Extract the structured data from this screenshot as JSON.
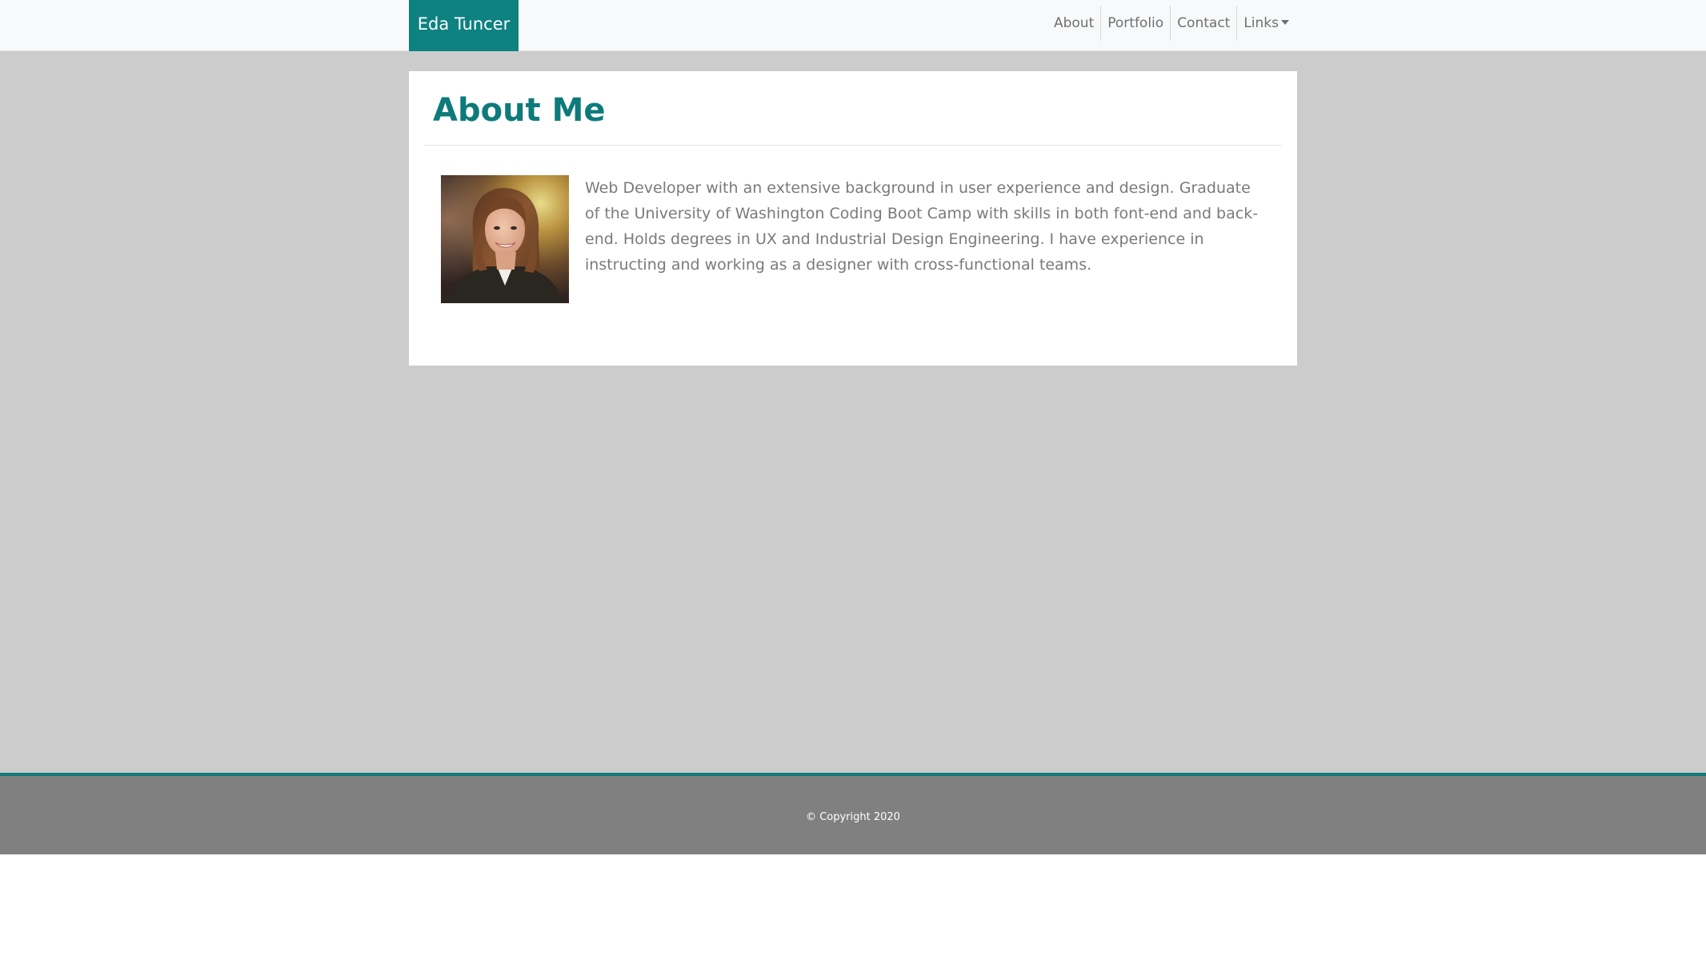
{
  "navbar": {
    "brand": "Eda Tuncer",
    "links": [
      {
        "label": "About"
      },
      {
        "label": "Portfolio"
      },
      {
        "label": "Contact"
      },
      {
        "label": "Links"
      }
    ]
  },
  "about": {
    "title": "About Me",
    "bio": "Web Developer with an extensive background in user experience and design. Graduate of the University of Washington Coding Boot Camp with skills in both font-end and back-end. Holds degrees in UX and Industrial Design Engineering. I have experience in instructing and working as a designer with cross-functional teams."
  },
  "footer": {
    "copyright": "© Copyright 2020"
  },
  "colors": {
    "accent": "#0e8181",
    "page_background": "#cccccc",
    "footer_background": "#808080"
  }
}
